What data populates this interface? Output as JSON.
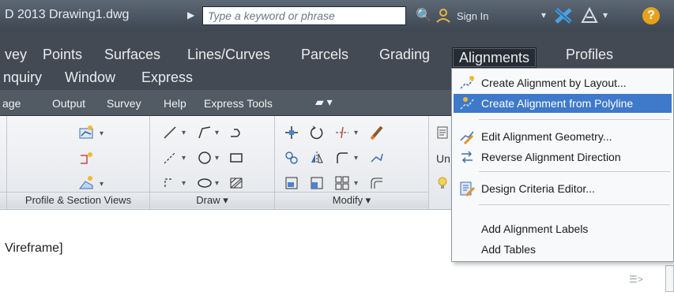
{
  "titlebar": {
    "app_title": "D 2013    Drawing1.dwg",
    "search_placeholder": "Type a keyword or phrase",
    "signin_label": "Sign In",
    "help_label": "?"
  },
  "menubar": {
    "row1": [
      "vey",
      "Points",
      "Surfaces",
      "Lines/Curves",
      "Parcels",
      "Grading",
      "Alignments",
      "Profiles"
    ],
    "row2": [
      "nquiry",
      "Window",
      "Express"
    ]
  },
  "ribbon_tabs": [
    "age",
    "Output",
    "Survey",
    "Help",
    "Express Tools"
  ],
  "panels": {
    "profile_section": "Profile & Section Views",
    "draw": "Draw ▾",
    "modify": "Modify ▾",
    "un_label": "Un"
  },
  "viewport": {
    "label": "Vireframe]"
  },
  "dropdown": {
    "items": [
      {
        "label": "Create Alignment by Layout...",
        "icon": "alignment-layout-icon"
      },
      {
        "label": "Create Alignment from Polyline",
        "icon": "alignment-polyline-icon",
        "highlighted": true
      },
      {
        "label": "Edit Alignment Geometry...",
        "icon": "edit-geometry-icon"
      },
      {
        "label": "Reverse Alignment Direction",
        "icon": "reverse-direction-icon"
      },
      {
        "label": "Design Criteria Editor...",
        "icon": "design-criteria-icon"
      },
      {
        "label": "Add Alignment Labels",
        "icon": ""
      },
      {
        "label": "Add Tables",
        "icon": ""
      }
    ]
  },
  "colors": {
    "titlebar": "#4b5561",
    "menubar": "#434a53",
    "highlight": "#3f79c9",
    "help": "#e6a21d"
  }
}
